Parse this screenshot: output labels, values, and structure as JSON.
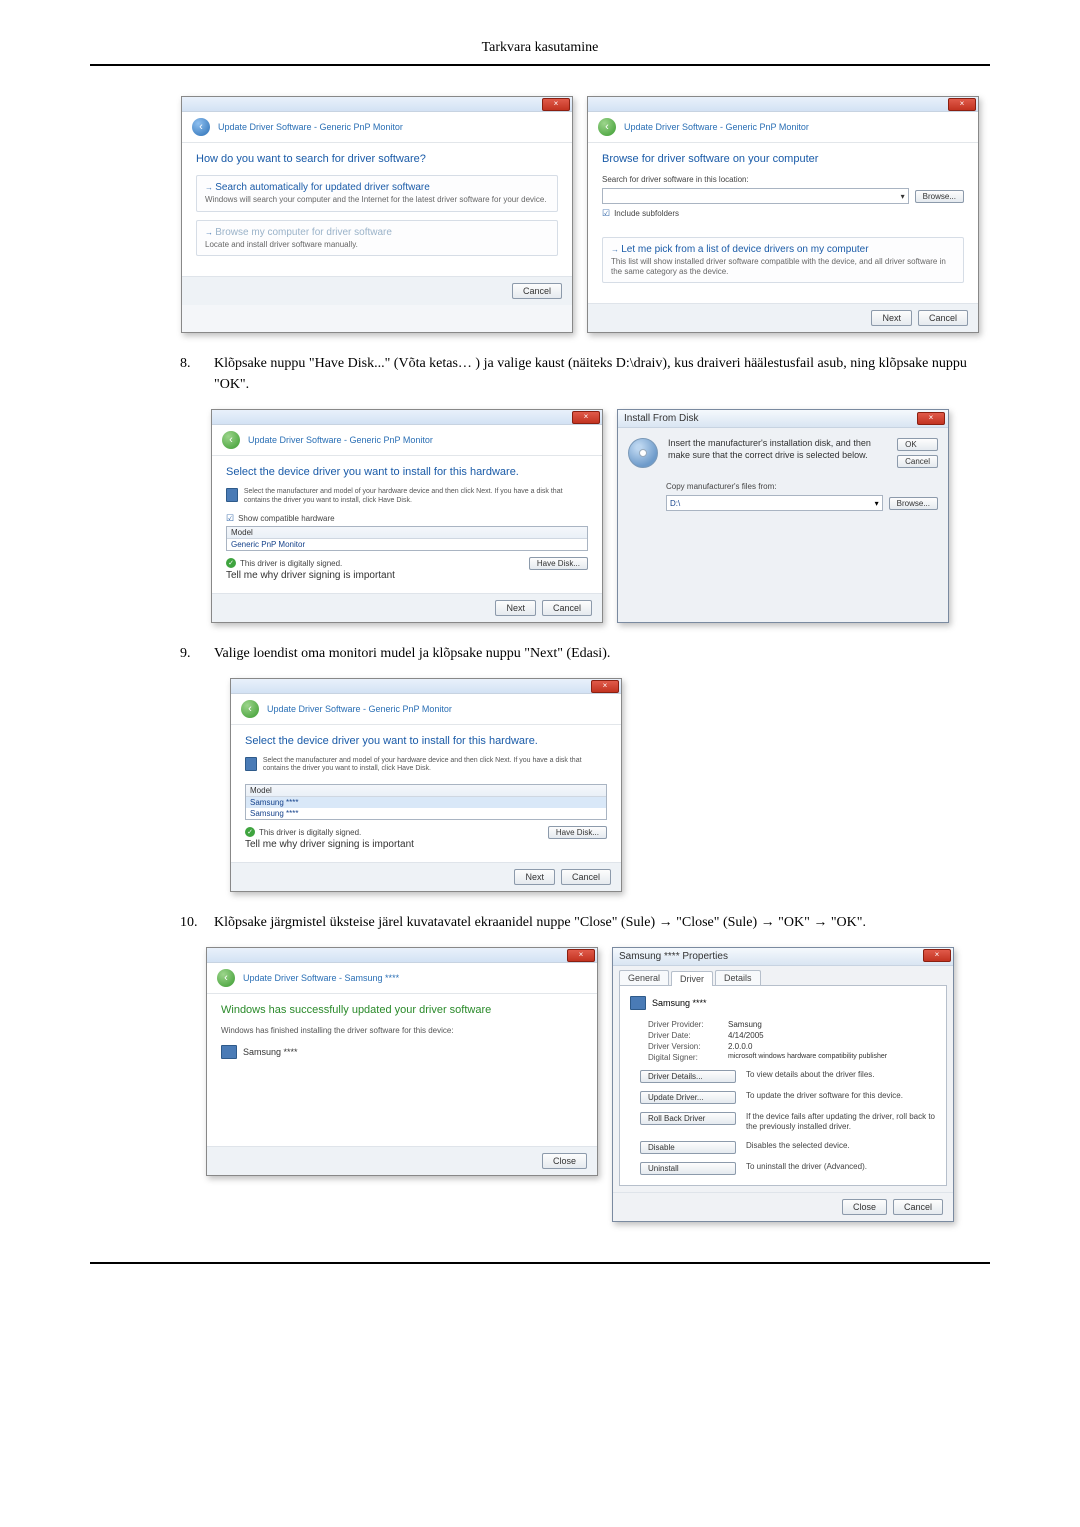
{
  "header": {
    "title": "Tarkvara kasutamine"
  },
  "step8": {
    "num": "8.",
    "text": "Klõpsake nuppu \"Have Disk...\" (Võta ketas… ) ja valige kaust (näiteks D:\\draiv), kus draiveri häälestusfail asub, ning klõpsake nuppu \"OK\"."
  },
  "step9": {
    "num": "9.",
    "text": "Valige loendist oma monitori mudel ja klõpsake nuppu \"Next\" (Edasi)."
  },
  "step10": {
    "num": "10.",
    "text": "Klõpsake järgmistel üksteise järel kuvatavatel ekraanidel nuppe \"Close\" (Sule) → \"Close\" (Sule) → \"OK\" → \"OK\"."
  },
  "dlg_search": {
    "crumb": "Update Driver Software - Generic PnP Monitor",
    "heading": "How do you want to search for driver software?",
    "opt1_title": "Search automatically for updated driver software",
    "opt1_desc": "Windows will search your computer and the Internet for the latest driver software for your device.",
    "opt2_title": "Browse my computer for driver software",
    "opt2_desc": "Locate and install driver software manually.",
    "cancel": "Cancel"
  },
  "dlg_browse": {
    "crumb": "Update Driver Software - Generic PnP Monitor",
    "heading": "Browse for driver software on your computer",
    "search_label": "Search for driver software in this location:",
    "path": "",
    "browse": "Browse...",
    "include": "Include subfolders",
    "pick_title": "Let me pick from a list of device drivers on my computer",
    "pick_desc": "This list will show installed driver software compatible with the device, and all driver software in the same category as the device.",
    "next": "Next",
    "cancel": "Cancel"
  },
  "dlg_select1": {
    "crumb": "Update Driver Software - Generic PnP Monitor",
    "heading": "Select the device driver you want to install for this hardware.",
    "sub": "Select the manufacturer and model of your hardware device and then click Next. If you have a disk that contains the driver you want to install, click Have Disk.",
    "compat": "Show compatible hardware",
    "model": "Model",
    "row1": "Generic PnP Monitor",
    "signed": "This driver is digitally signed.",
    "tell": "Tell me why driver signing is important",
    "havedisk": "Have Disk...",
    "next": "Next",
    "cancel": "Cancel"
  },
  "dlg_ifd": {
    "title": "Install From Disk",
    "msg": "Insert the manufacturer's installation disk, and then make sure that the correct drive is selected below.",
    "ok": "OK",
    "cancel": "Cancel",
    "copy_label": "Copy manufacturer's files from:",
    "path": "D:\\",
    "browse": "Browse..."
  },
  "dlg_select2": {
    "crumb": "Update Driver Software - Generic PnP Monitor",
    "heading": "Select the device driver you want to install for this hardware.",
    "sub": "Select the manufacturer and model of your hardware device and then click Next. If you have a disk that contains the driver you want to install, click Have Disk.",
    "model": "Model",
    "row1": "Samsung ****",
    "row2": "Samsung ****",
    "signed": "This driver is digitally signed.",
    "tell": "Tell me why driver signing is important",
    "havedisk": "Have Disk...",
    "next": "Next",
    "cancel": "Cancel"
  },
  "dlg_done": {
    "crumb": "Update Driver Software - Samsung ****",
    "heading": "Windows has successfully updated your driver software",
    "sub": "Windows has finished installing the driver software for this device:",
    "device": "Samsung ****",
    "close": "Close"
  },
  "dlg_props": {
    "title": "Samsung **** Properties",
    "tab_general": "General",
    "tab_driver": "Driver",
    "tab_details": "Details",
    "device": "Samsung ****",
    "provider_k": "Driver Provider:",
    "provider_v": "Samsung",
    "date_k": "Driver Date:",
    "date_v": "4/14/2005",
    "version_k": "Driver Version:",
    "version_v": "2.0.0.0",
    "signer_k": "Digital Signer:",
    "signer_v": "microsoft windows hardware compatibility publisher",
    "btn_details": "Driver Details...",
    "btn_details_d": "To view details about the driver files.",
    "btn_update": "Update Driver...",
    "btn_update_d": "To update the driver software for this device.",
    "btn_rollback": "Roll Back Driver",
    "btn_rollback_d": "If the device fails after updating the driver, roll back to the previously installed driver.",
    "btn_disable": "Disable",
    "btn_disable_d": "Disables the selected device.",
    "btn_uninstall": "Uninstall",
    "btn_uninstall_d": "To uninstall the driver (Advanced).",
    "close": "Close",
    "cancel": "Cancel"
  }
}
